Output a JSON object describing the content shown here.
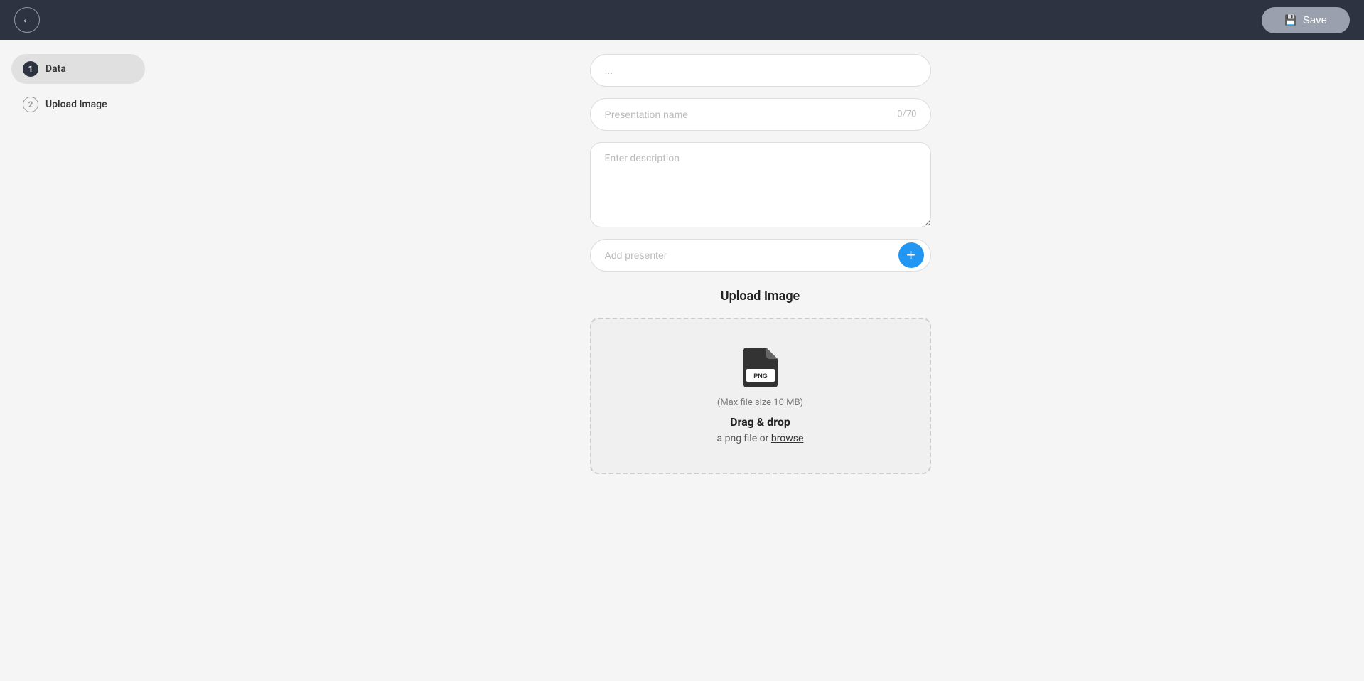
{
  "header": {
    "back_button_label": "←",
    "save_button_label": "Save",
    "save_icon": "💾"
  },
  "sidebar": {
    "items": [
      {
        "id": "data",
        "step": "1",
        "label": "Data",
        "active": true,
        "badge_style": "filled"
      },
      {
        "id": "upload-image",
        "step": "2",
        "label": "Upload Image",
        "active": false,
        "badge_style": "outlined"
      }
    ]
  },
  "form": {
    "presentation_name_placeholder": "Presentation name",
    "presentation_name_char_count": "0/70",
    "description_placeholder": "Enter description",
    "presenter_placeholder": "Add presenter",
    "add_presenter_label": "+"
  },
  "upload": {
    "section_title": "Upload Image",
    "max_size_text": "(Max file size 10 MB)",
    "drag_drop_text": "Drag & drop",
    "browse_prefix": "a png file or",
    "browse_label": "browse"
  }
}
